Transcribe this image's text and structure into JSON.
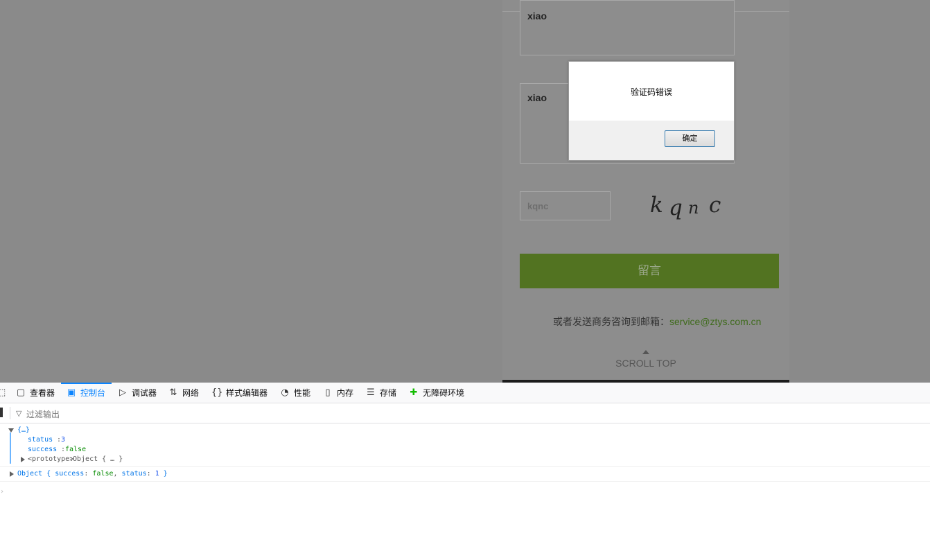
{
  "page": {
    "form": {
      "field1_value": "xiao",
      "field2_value": "xiao",
      "captcha_value": "kqnc",
      "captcha_chars": [
        "k",
        "q",
        "n",
        "c"
      ],
      "submit_label": "留言"
    },
    "contact_text": "或者发送商务咨询到邮箱：",
    "contact_email": "service@ztys.com.cn",
    "scroll_top_label": "SCROLL TOP"
  },
  "dialog": {
    "message": "验证码错误",
    "ok_label": "确定"
  },
  "devtools": {
    "tabs": [
      {
        "label": "查看器",
        "icon": "inspector-icon"
      },
      {
        "label": "控制台",
        "icon": "console-icon",
        "active": true
      },
      {
        "label": "调试器",
        "icon": "debugger-icon"
      },
      {
        "label": "网络",
        "icon": "network-icon"
      },
      {
        "label": "样式编辑器",
        "icon": "style-editor-icon"
      },
      {
        "label": "性能",
        "icon": "performance-icon"
      },
      {
        "label": "内存",
        "icon": "memory-icon"
      },
      {
        "label": "存储",
        "icon": "storage-icon"
      },
      {
        "label": "无障碍环境",
        "icon": "accessibility-icon"
      }
    ],
    "filter_placeholder": "过滤输出",
    "console": {
      "entry1_header": "{…}",
      "entry1_status_key": "status",
      "entry1_status_val": "3",
      "entry1_success_key": "success",
      "entry1_success_val": "false",
      "entry1_proto_key": "<prototype>",
      "entry1_proto_val": "Object { … }",
      "entry2_prefix": "Object { ",
      "entry2_success_key": "success",
      "entry2_success_val": "false",
      "entry2_status_key": "status",
      "entry2_status_val": "1",
      "entry2_suffix": " }"
    }
  }
}
